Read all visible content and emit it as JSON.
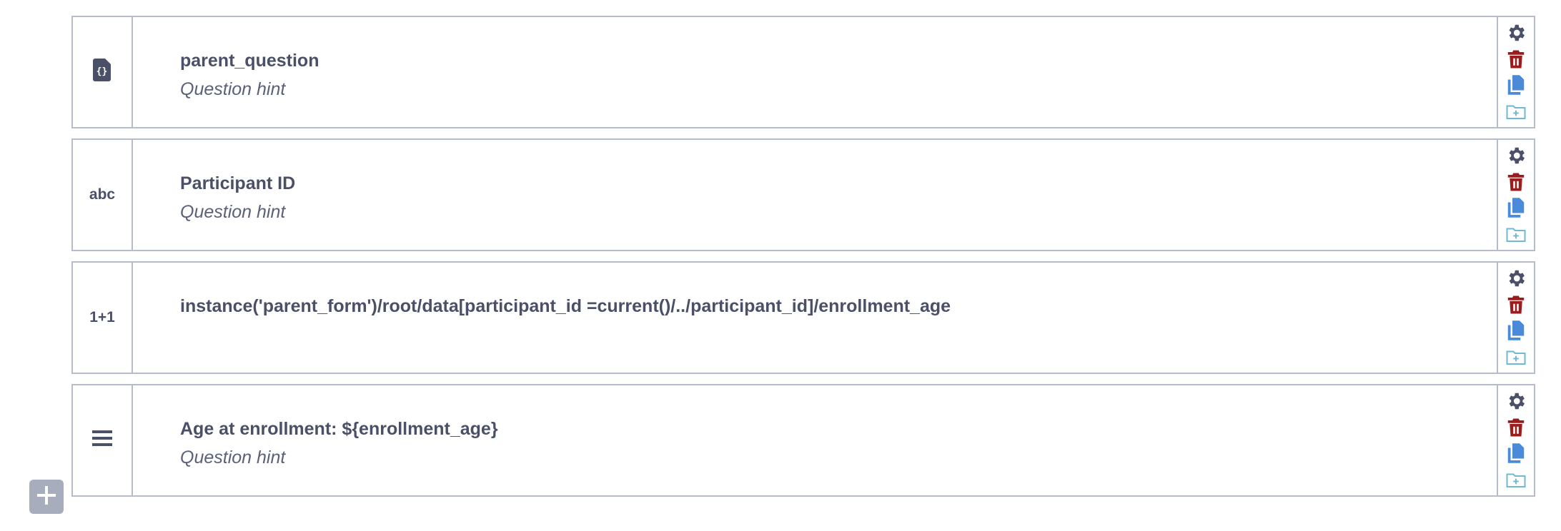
{
  "rows": [
    {
      "type_icon": "reference-file-icon",
      "type_text": "",
      "label": "parent_question",
      "hint": "Question hint"
    },
    {
      "type_icon": "text-type-icon",
      "type_text": "abc",
      "label": "Participant ID",
      "hint": "Question hint"
    },
    {
      "type_icon": "calculate-type-icon",
      "type_text": "1+1",
      "label": "instance('parent_form')/root/data[participant_id =current()/../participant_id]/enrollment_age",
      "hint": ""
    },
    {
      "type_icon": "note-type-icon",
      "type_text": "",
      "label": "Age at enrollment: ${enrollment_age}",
      "hint": "Question hint"
    }
  ],
  "tool_icons": [
    "gear-icon",
    "trash-icon",
    "copy-icon",
    "folder-plus-icon"
  ],
  "colors": {
    "gear": "#4a5067",
    "trash": "#9b1c1c",
    "copy": "#4a8ad8",
    "folder": "#6fb9d3",
    "border": "#b7bccb",
    "add_button": "#a8adbd"
  },
  "add_button_icon": "plus-icon"
}
